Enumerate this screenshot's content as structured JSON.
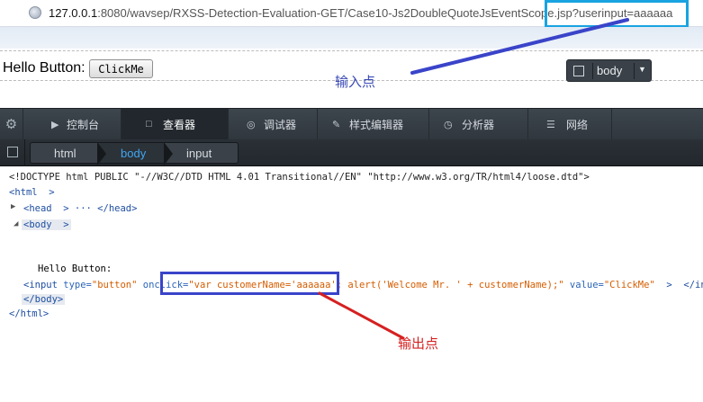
{
  "urlbar": {
    "host": "127.0.0.1",
    "rest": ":8080/wavsep/RXSS-Detection-Evaluation-GET/Case10-Js2DoubleQuoteJsEventScope.jsp?userinput=aaaaaa"
  },
  "page": {
    "hello_text": "Hello Button:",
    "button_label": "ClickMe"
  },
  "annotations": {
    "input_point": "输入点",
    "output_point": "输出点",
    "highlight_color": "#19a3e0",
    "box_color": "#3a44c9",
    "arrow_in_color": "#3a44c9",
    "arrow_out_color": "#d62020"
  },
  "node_picker": {
    "label": "body"
  },
  "devtools": {
    "tabs": [
      {
        "icon": "console-icon",
        "label": "控制台"
      },
      {
        "icon": "inspector-icon",
        "label": "查看器"
      },
      {
        "icon": "debugger-icon",
        "label": "调试器"
      },
      {
        "icon": "style-editor-icon",
        "label": "样式编辑器"
      },
      {
        "icon": "profiler-icon",
        "label": "分析器"
      },
      {
        "icon": "network-icon",
        "label": "网络"
      }
    ],
    "active_tab": "查看器",
    "breadcrumbs": [
      "html",
      "body",
      "input"
    ],
    "selected_crumb": "body"
  },
  "markup": {
    "doctype": "<!DOCTYPE html PUBLIC \"-//W3C//DTD HTML 4.01 Transitional//EN\" \"http://www.w3.org/TR/html4/loose.dtd\">",
    "html_open": "<html  >",
    "head": "<head  > ··· </head>",
    "body_open": "<body  >",
    "text_node": "Hello Button:",
    "input_open": "<input",
    "type_attr": "type=",
    "type_val": "\"button\"",
    "onclick_attr": "onclick=",
    "onclick_val": "\"var customerName='aaaaaa'; alert('Welcome Mr. ' + customerName);\"",
    "value_attr": "value=",
    "value_val": "\"ClickMe\"",
    "input_close": ">  </input>",
    "body_close": "</body>",
    "html_close": "</html>"
  }
}
